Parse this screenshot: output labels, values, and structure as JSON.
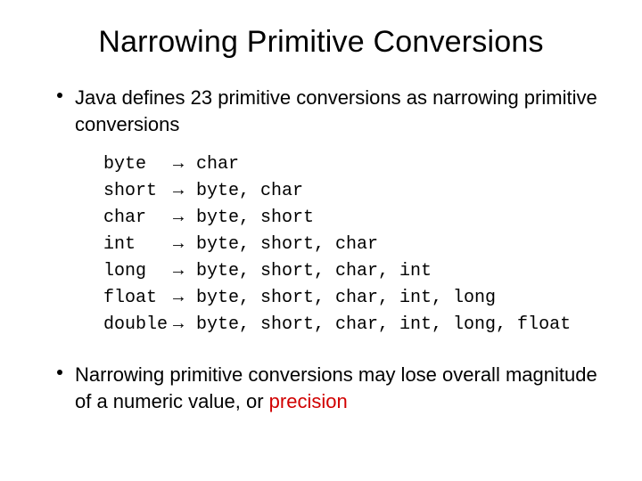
{
  "title": "Narrowing Primitive Conversions",
  "bullets": [
    {
      "text": "Java defines 23 primitive conversions as narrowing primitive conversions"
    }
  ],
  "conversions": [
    {
      "from": "byte",
      "arrow": "→",
      "to": "char"
    },
    {
      "from": "short",
      "arrow": "→",
      "to": "byte, char"
    },
    {
      "from": "char",
      "arrow": "→",
      "to": "byte, short"
    },
    {
      "from": "int",
      "arrow": "→",
      "to": "byte, short, char"
    },
    {
      "from": "long",
      "arrow": "→",
      "to": "byte, short, char, int"
    },
    {
      "from": "float",
      "arrow": "→",
      "to": "byte, short, char, int, long"
    },
    {
      "from": "double",
      "arrow": "→",
      "to": "byte, short, char, int, long, float"
    }
  ],
  "bullet2_pre": "Narrowing primitive conversions may lose overall magnitude of a numeric value, or ",
  "bullet2_red": "precision"
}
